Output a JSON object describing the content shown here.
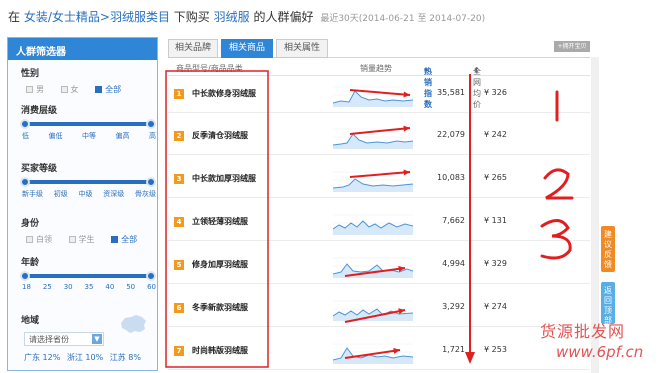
{
  "breadcrumb": {
    "prefix": "在",
    "category_path": "女装/女士精品>羽绒服类目",
    "middle": "下购买",
    "keyword": "羽绒服",
    "suffix": "的人群偏好",
    "date_range": "最近30天(2014-06-21 至 2014-07-20)"
  },
  "filter_panel": {
    "title": "人群筛选器",
    "gender": {
      "label": "性别",
      "options": [
        "男",
        "女",
        "全部"
      ],
      "selected": "全部"
    },
    "consumption": {
      "label": "消费层级",
      "ticks": [
        "低",
        "偏低",
        "中等",
        "偏高",
        "高"
      ]
    },
    "buyer_level": {
      "label": "买家等级",
      "ticks": [
        "新手级",
        "初级",
        "中级",
        "资深级",
        "骨灰级"
      ]
    },
    "identity": {
      "label": "身份",
      "options": [
        "白领",
        "学生",
        "全部"
      ],
      "selected": "全部"
    },
    "age": {
      "label": "年龄",
      "ticks": [
        "18",
        "25",
        "30",
        "35",
        "40",
        "50",
        "60"
      ]
    },
    "region": {
      "label": "地域",
      "placeholder": "请选择省份",
      "top_regions": [
        "广东 12%",
        "浙江 10%",
        "江苏 8%"
      ]
    }
  },
  "tabs": [
    {
      "label": "相关品牌",
      "active": false
    },
    {
      "label": "相关商品",
      "active": true
    },
    {
      "label": "相关属性",
      "active": false
    }
  ],
  "top_button_label": "+拥开宝贝",
  "table": {
    "headers": {
      "name": "商品型号/商品品类",
      "trend": "销量趋势",
      "hot_index": "热销指数",
      "avg_price": "全网均价"
    },
    "rows": [
      {
        "rank": "1",
        "name": "中长款修身羽绒服",
        "hot_index": "35,581",
        "price": "¥ 326"
      },
      {
        "rank": "2",
        "name": "反季清仓羽绒服",
        "hot_index": "22,079",
        "price": "¥ 242"
      },
      {
        "rank": "3",
        "name": "中长款加厚羽绒服",
        "hot_index": "10,083",
        "price": "¥ 265"
      },
      {
        "rank": "4",
        "name": "立领轻薄羽绒服",
        "hot_index": "7,662",
        "price": "¥ 131"
      },
      {
        "rank": "5",
        "name": "修身加厚羽绒服",
        "hot_index": "4,994",
        "price": "¥ 329"
      },
      {
        "rank": "6",
        "name": "冬季新款羽绒服",
        "hot_index": "3,292",
        "price": "¥ 274"
      },
      {
        "rank": "7",
        "name": "时尚韩版羽绒服",
        "hot_index": "1,721",
        "price": "¥ 253"
      }
    ]
  },
  "float_buttons": {
    "feedback": "建议反馈",
    "back_top": "返回顶部"
  },
  "watermark": {
    "line1": "货源批发网",
    "line2": "www.6pf.cn"
  },
  "colors": {
    "accent": "#2f86d6",
    "rank_badge": "#f39a1e",
    "annotation": "#e02020"
  }
}
